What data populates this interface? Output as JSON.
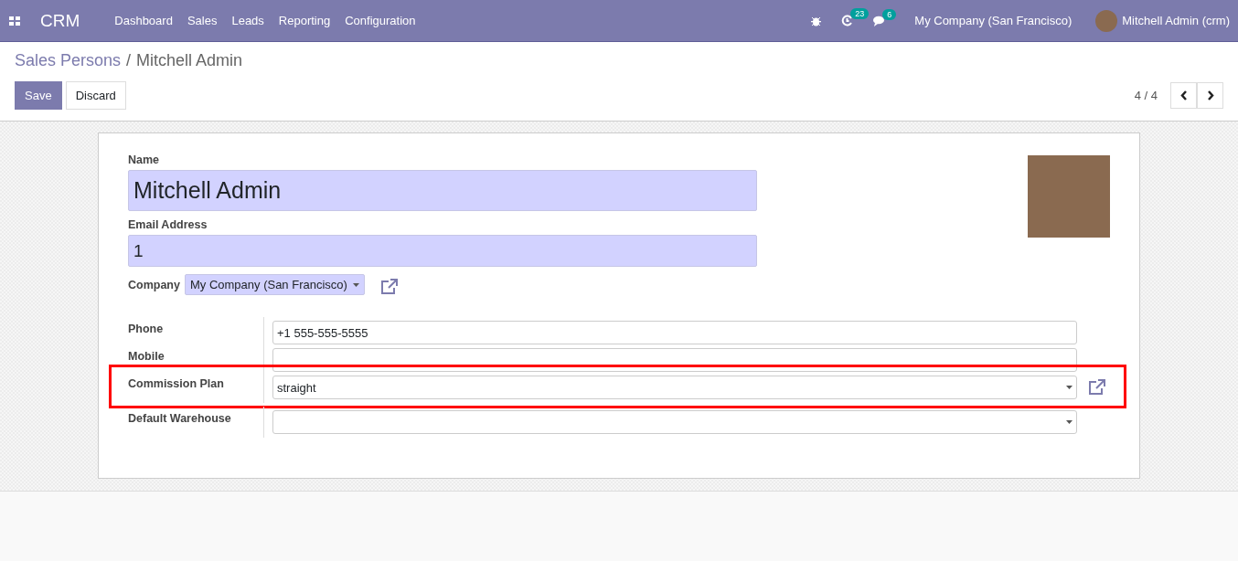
{
  "navbar": {
    "app_name": "CRM",
    "menu": [
      "Dashboard",
      "Sales",
      "Leads",
      "Reporting",
      "Configuration"
    ],
    "activity_count": "23",
    "message_count": "6",
    "company": "My Company (San Francisco)",
    "user": "Mitchell Admin (crm)"
  },
  "breadcrumb": {
    "parent": "Sales Persons",
    "separator": "/",
    "current": "Mitchell Admin"
  },
  "buttons": {
    "save": "Save",
    "discard": "Discard"
  },
  "pager": "4 / 4",
  "form": {
    "name_label": "Name",
    "name": "Mitchell Admin",
    "email_label": "Email Address",
    "email": "1",
    "company_label": "Company",
    "company": "My Company (San Francisco)",
    "groups": [
      {
        "rows": [
          {
            "label": "Phone",
            "kind": "text",
            "value": "+1 555-555-5555",
            "external_link": false,
            "highlighted": false
          },
          {
            "label": "Mobile",
            "kind": "text",
            "value": "",
            "external_link": false,
            "highlighted": false
          },
          {
            "label": "Commission Plan",
            "kind": "select",
            "value": "straight",
            "external_link": true,
            "highlighted": true
          }
        ]
      },
      {
        "rows": [
          {
            "label": "Default Warehouse",
            "kind": "select",
            "value": "",
            "external_link": false,
            "highlighted": false
          }
        ]
      }
    ]
  }
}
